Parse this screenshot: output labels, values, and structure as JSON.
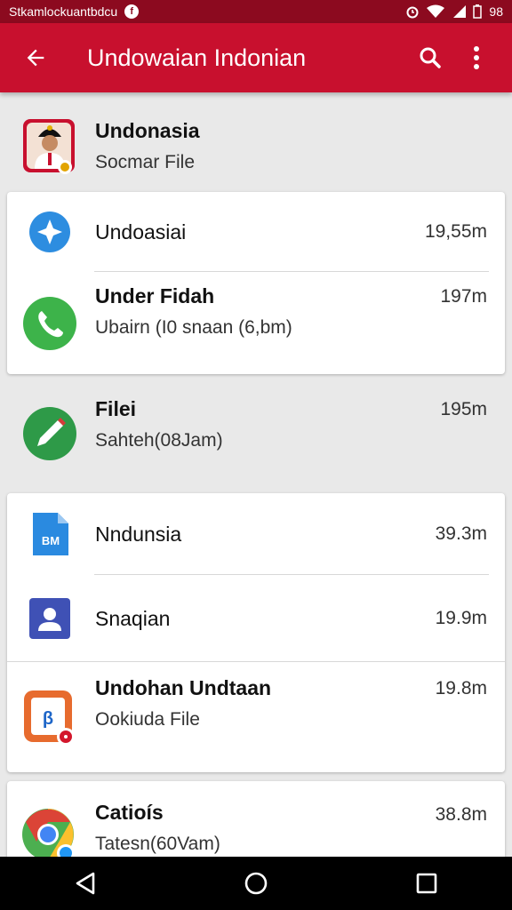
{
  "status_bar": {
    "left_text": "Stkamlockuantbdcu",
    "notification_badge": "f",
    "battery_text": "98"
  },
  "app_bar": {
    "title": "Undowaian Indonian",
    "icons": [
      "back-arrow-icon",
      "search-icon",
      "more-vert-icon"
    ]
  },
  "items": [
    {
      "title": "Undonasia",
      "subtitle": "Socmar File",
      "size": "",
      "icon": "character-app-icon",
      "bold": true
    },
    {
      "title": "Undoasiai",
      "subtitle": "",
      "size": "19,55m",
      "icon": "compass-icon",
      "bold": false
    },
    {
      "title": "Under Fidah",
      "subtitle": "Ubairn (I0 snaan (6,bm)",
      "size": "197m",
      "icon": "phone-icon",
      "bold": true
    },
    {
      "title": "Filei",
      "subtitle": "Sahteh(08Jam)",
      "size": "195m",
      "icon": "pen-icon",
      "bold": true
    },
    {
      "title": "Nndunsia",
      "subtitle": "",
      "size": "39.3m",
      "icon": "document-icon",
      "doc_label": "BM",
      "bold": false
    },
    {
      "title": "Snaqian",
      "subtitle": "",
      "size": "19.9m",
      "icon": "contact-icon",
      "bold": false
    },
    {
      "title": "Undohan Undtaan",
      "subtitle": "Ookiuda File",
      "size": "19.8m",
      "icon": "clipboard-icon",
      "bold": true
    },
    {
      "title": "Catioís",
      "subtitle": "Tatesn(60Vam)",
      "size": "38.8m",
      "icon": "chrome-icon",
      "bold": true
    }
  ],
  "colors": {
    "primary": "#c8102e",
    "status_bar": "#8c0a1f",
    "background": "#e9e9e9",
    "card": "#ffffff"
  },
  "nav_bar": {
    "icons": [
      "back-triangle-icon",
      "home-circle-icon",
      "recents-square-icon"
    ]
  }
}
